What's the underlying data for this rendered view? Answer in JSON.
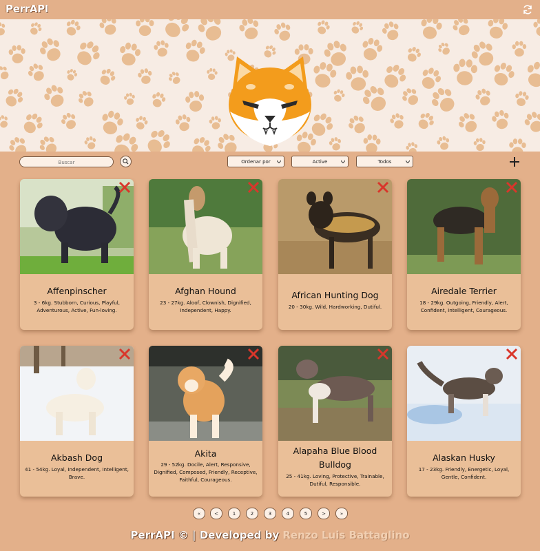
{
  "app": {
    "brand": "PerrAPI"
  },
  "search": {
    "placeholder": "Buscar"
  },
  "filters": {
    "order": "Ordenar por",
    "status": "Active",
    "source": "Todos"
  },
  "cards": [
    {
      "name": "Affenpinscher",
      "desc": "3 - 6kg. Stubborn, Curious, Playful, Adventurous, Active, Fun-loving."
    },
    {
      "name": "Afghan Hound",
      "desc": "23 - 27kg. Aloof, Clownish, Dignified, Independent, Happy."
    },
    {
      "name": "African Hunting Dog",
      "desc": "20 - 30kg. Wild, Hardworking, Dutiful."
    },
    {
      "name": "Airedale Terrier",
      "desc": "18 - 29kg. Outgoing, Friendly, Alert, Confident, Intelligent, Courageous."
    },
    {
      "name": "Akbash Dog",
      "desc": "41 - 54kg. Loyal, Independent, Intelligent, Brave."
    },
    {
      "name": "Akita",
      "desc": "29 - 52kg. Docile, Alert, Responsive, Dignified, Composed, Friendly, Receptive, Faithful, Courageous."
    },
    {
      "name": "Alapaha Blue Blood Bulldog",
      "desc": "25 - 41kg. Loving, Protective, Trainable, Dutiful, Responsible."
    },
    {
      "name": "Alaskan Husky",
      "desc": "17 - 23kg. Friendly, Energetic, Loyal, Gentle, Confident."
    }
  ],
  "pagination": {
    "first": "«",
    "prev": "<",
    "p1": "1",
    "p2": "2",
    "p3": "3",
    "p4": "4",
    "p5": "5",
    "next": ">",
    "last": "»"
  },
  "footer": {
    "text": "PerrAPI © | Developed by ",
    "author": "Renzo Luis Battaglino"
  },
  "colors": {
    "background": "#e3b08a",
    "card": "#eabf98",
    "banner": "#f7ece4",
    "paw": "#e8bd93",
    "close": "#d9362b"
  },
  "icons": {
    "refresh": "refresh-icon",
    "search": "search-icon",
    "add": "plus-icon",
    "close": "close-icon",
    "logo": "shiba-logo"
  }
}
